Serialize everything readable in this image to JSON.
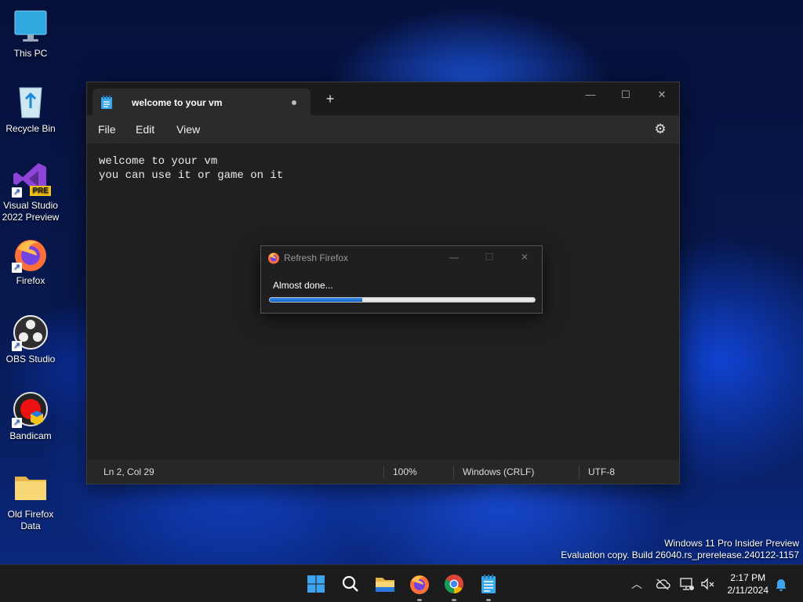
{
  "desktop": {
    "icons": [
      {
        "label": "This PC",
        "icon": "monitor-icon"
      },
      {
        "label": "Recycle Bin",
        "icon": "recycle-bin-icon"
      },
      {
        "label": "Visual Studio 2022 Preview",
        "icon": "visual-studio-icon",
        "badge": "PRE"
      },
      {
        "label": "Firefox",
        "icon": "firefox-icon"
      },
      {
        "label": "OBS Studio",
        "icon": "obs-icon"
      },
      {
        "label": "Bandicam",
        "icon": "bandicam-icon"
      },
      {
        "label": "Old Firefox Data",
        "icon": "folder-icon"
      }
    ]
  },
  "notepad": {
    "tab_title": "welcome to your vm",
    "new_tab": "+",
    "controls": {
      "minimize": "—",
      "maximize": "☐",
      "close": "✕"
    },
    "menu": [
      "File",
      "Edit",
      "View"
    ],
    "content_line1": "welcome to your vm",
    "content_line2": "you can use it or game on it",
    "status": {
      "position": "Ln 2, Col 29",
      "zoom": "100%",
      "line_ending": "Windows (CRLF)",
      "encoding": "UTF-8"
    }
  },
  "dialog": {
    "title": "Refresh Firefox",
    "message": "Almost done...",
    "progress": 0.35,
    "controls": {
      "minimize": "—",
      "maximize": "☐",
      "close": "✕"
    }
  },
  "watermark": {
    "line1": "Windows 11 Pro Insider Preview",
    "line2": "Evaluation copy. Build 26040.rs_prerelease.240122-1157"
  },
  "taskbar": {
    "apps": [
      "start-icon",
      "search-icon",
      "file-explorer-icon",
      "firefox-icon",
      "chrome-icon",
      "notepad-icon"
    ],
    "clock_time": "2:17 PM",
    "clock_date": "2/11/2024"
  },
  "colors": {
    "accent": "#0e62c9",
    "taskbar": "#1c1c1c",
    "window": "#202020"
  }
}
